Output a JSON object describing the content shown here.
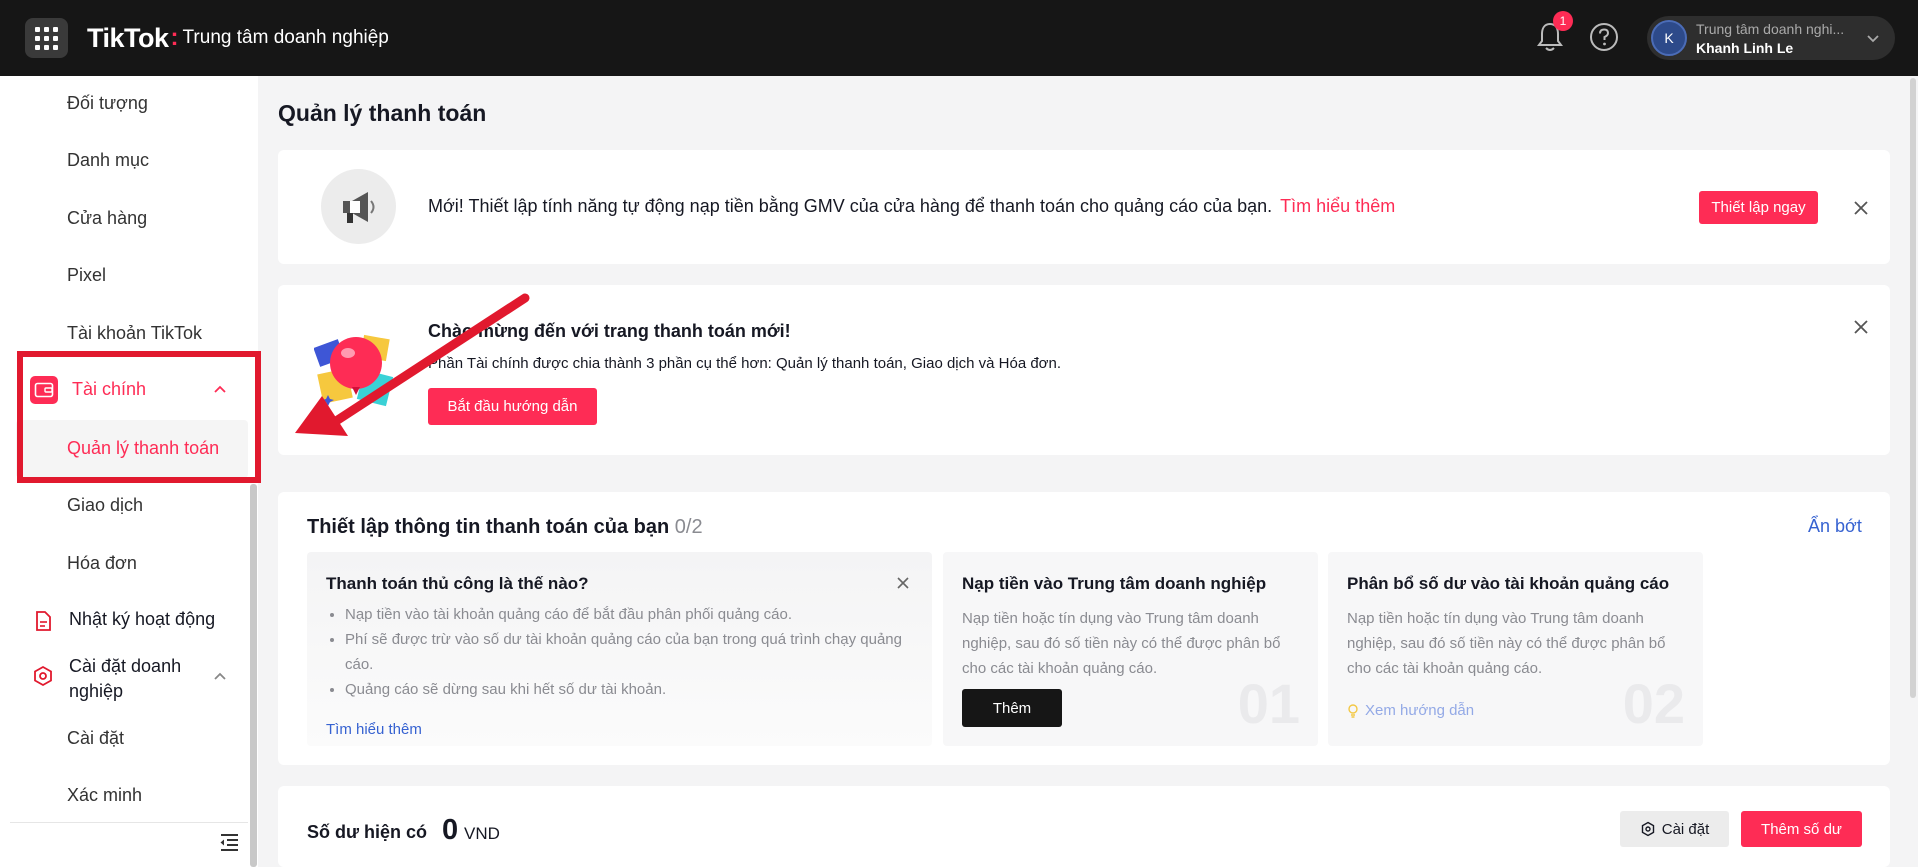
{
  "topbar": {
    "logo": "TikTok",
    "product": "Trung tâm doanh nghiệp",
    "notification_count": "1",
    "account_org": "Trung tâm doanh nghi...",
    "account_user": "Khanh Linh Le",
    "avatar_initial": "K"
  },
  "sidebar": {
    "items_top": [
      "Đối tượng",
      "Danh mục",
      "Cửa hàng",
      "Pixel",
      "Tài khoản TikTok"
    ],
    "finance_group": "Tài chính",
    "finance_items": [
      "Quản lý thanh toán",
      "Giao dịch",
      "Hóa đơn"
    ],
    "activity_log": "Nhật ký hoạt động",
    "business_settings": "Cài đặt doanh nghiệp",
    "business_items": [
      "Cài đặt",
      "Xác minh"
    ]
  },
  "page": {
    "title": "Quản lý thanh toán"
  },
  "notice": {
    "message": "Mới! Thiết lập tính năng tự động nạp tiền bằng GMV của cửa hàng để thanh toán cho quảng cáo của bạn.",
    "link": "Tìm hiểu thêm",
    "button": "Thiết lập ngay"
  },
  "welcome": {
    "title": "Chào mừng đến với trang thanh toán mới!",
    "description": "Phần Tài chính được chia thành 3 phần cụ thể hơn: Quản lý thanh toán, Giao dịch và Hóa đơn.",
    "button": "Bắt đầu hướng dẫn"
  },
  "setup": {
    "title": "Thiết lập thông tin thanh toán của bạn",
    "progress": "0/2",
    "hide_link": "Ẩn bớt",
    "manual": {
      "title": "Thanh toán thủ công là thế nào?",
      "bullets": [
        "Nạp tiền vào tài khoản quảng cáo để bắt đầu phân phối quảng cáo.",
        "Phí sẽ được trừ vào số dư tài khoản quảng cáo của bạn trong quá trình chạy quảng cáo.",
        "Quảng cáo sẽ dừng sau khi hết số dư tài khoản."
      ],
      "learn_more": "Tìm hiểu thêm"
    },
    "step1": {
      "title": "Nạp tiền vào Trung tâm doanh nghiệp",
      "description": "Nạp tiền hoặc tín dụng vào Trung tâm doanh nghiệp, sau đó số tiền này có thể được phân bổ cho các tài khoản quảng cáo.",
      "button": "Thêm",
      "number": "01"
    },
    "step2": {
      "title": "Phân bổ số dư vào tài khoản quảng cáo",
      "description": "Nạp tiền hoặc tín dụng vào Trung tâm doanh nghiệp, sau đó số tiền này có thể được phân bổ cho các tài khoản quảng cáo.",
      "guide_link": "Xem hướng dẫn",
      "number": "02"
    }
  },
  "balance": {
    "label": "Số dư hiện có",
    "value": "0",
    "currency": "VND",
    "settings_button": "Cài đặt",
    "add_button": "Thêm số dư"
  },
  "colors": {
    "brand": "#fe2c55",
    "link": "#3662d1",
    "annotation": "#e1192e"
  }
}
